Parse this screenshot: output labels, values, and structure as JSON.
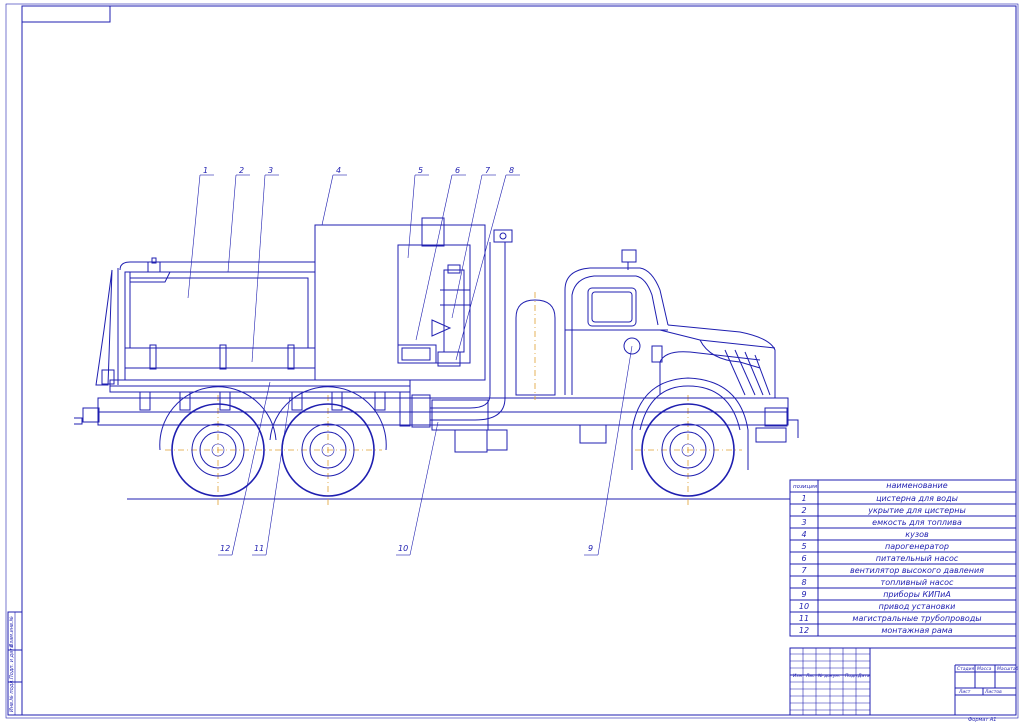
{
  "callouts": [
    "1",
    "2",
    "3",
    "4",
    "5",
    "6",
    "7",
    "8",
    "9",
    "10",
    "11",
    "12"
  ],
  "table": {
    "header": {
      "pos": "позиция",
      "name": "наименование"
    },
    "rows": [
      {
        "pos": "1",
        "name": "цистерна для воды"
      },
      {
        "pos": "2",
        "name": "укрытие для цистерны"
      },
      {
        "pos": "3",
        "name": "емкость для топлива"
      },
      {
        "pos": "4",
        "name": "кузов"
      },
      {
        "pos": "5",
        "name": "парогенератор"
      },
      {
        "pos": "6",
        "name": "питательный насос"
      },
      {
        "pos": "7",
        "name": "вентилятор высокого давления"
      },
      {
        "pos": "8",
        "name": "топливный насос"
      },
      {
        "pos": "9",
        "name": "приборы КИПиА"
      },
      {
        "pos": "10",
        "name": "привод установки"
      },
      {
        "pos": "11",
        "name": "магистральные трубопроводы"
      },
      {
        "pos": "12",
        "name": "монтажная рама"
      }
    ]
  },
  "title_block": {
    "cols": [
      "Изм",
      "Лист",
      "№ докум.",
      "Подп.",
      "Дата"
    ],
    "stage": "Стадия",
    "mass": "Масса",
    "scale": "Масштаб",
    "sheet": "Лист",
    "sheets": "Листов",
    "format": "Формат   А1"
  },
  "side_strip": [
    "Инв.№ подл.",
    "Подп. и дата",
    "Взам.инв.№"
  ]
}
